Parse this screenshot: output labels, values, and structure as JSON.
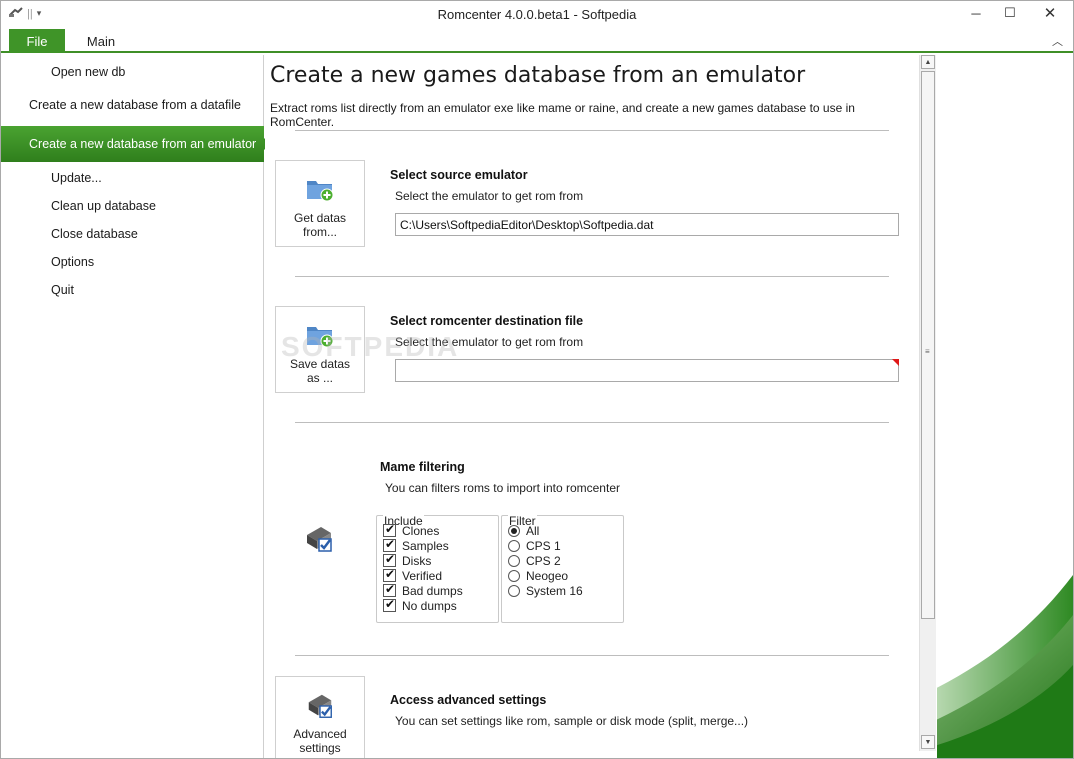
{
  "window": {
    "title": "Romcenter 4.0.0.beta1 - Softpedia",
    "minimize_glyph": "─",
    "maximize_glyph": "☐",
    "close_glyph": "✕"
  },
  "ribbon": {
    "file_tab": "File",
    "main_tab": "Main",
    "collapse_glyph": "︿"
  },
  "sidebar": {
    "items": [
      {
        "label": "Open new db"
      },
      {
        "label": "Create a new database from a datafile"
      },
      {
        "label": "Create a new database from an emulator"
      },
      {
        "label": "Update..."
      },
      {
        "label": "Clean up database"
      },
      {
        "label": "Close database"
      },
      {
        "label": "Options"
      },
      {
        "label": "Quit"
      }
    ]
  },
  "page": {
    "title": "Create a new games database from an emulator",
    "description": "Extract roms list directly from an emulator exe like mame or raine, and create a new games database to use in RomCenter."
  },
  "source": {
    "button_label_1": "Get datas",
    "button_label_2": "from...",
    "title": "Select source emulator",
    "subtitle": "Select the emulator to get rom from",
    "path_value": "C:\\Users\\SoftpediaEditor\\Desktop\\Softpedia.dat"
  },
  "destination": {
    "button_label_1": "Save datas",
    "button_label_2": "as ...",
    "title": "Select romcenter destination file",
    "subtitle": "Select the emulator to get rom from",
    "path_value": ""
  },
  "filtering": {
    "title": "Mame filtering",
    "subtitle": "You can filters roms to import into romcenter",
    "include_legend": "Include",
    "include_options": [
      "Clones",
      "Samples",
      "Disks",
      "Verified",
      "Bad dumps",
      "No dumps"
    ],
    "include_checked": [
      true,
      true,
      true,
      true,
      true,
      true
    ],
    "filter_legend": "Filter",
    "filter_options": [
      "All",
      "CPS 1",
      "CPS 2",
      "Neogeo",
      "System 16"
    ],
    "filter_selected": "All"
  },
  "advanced": {
    "button_label_1": "Advanced",
    "button_label_2": "settings",
    "title": "Access advanced settings",
    "subtitle": "You can set settings like rom, sample or disk mode (split, merge...)"
  },
  "watermark": "SOFTPEDIA",
  "colors": {
    "accent_green": "#3f9428",
    "active_item_top": "#4aa331",
    "active_item_bottom": "#2f7f1c",
    "error_marker": "#e01818"
  }
}
